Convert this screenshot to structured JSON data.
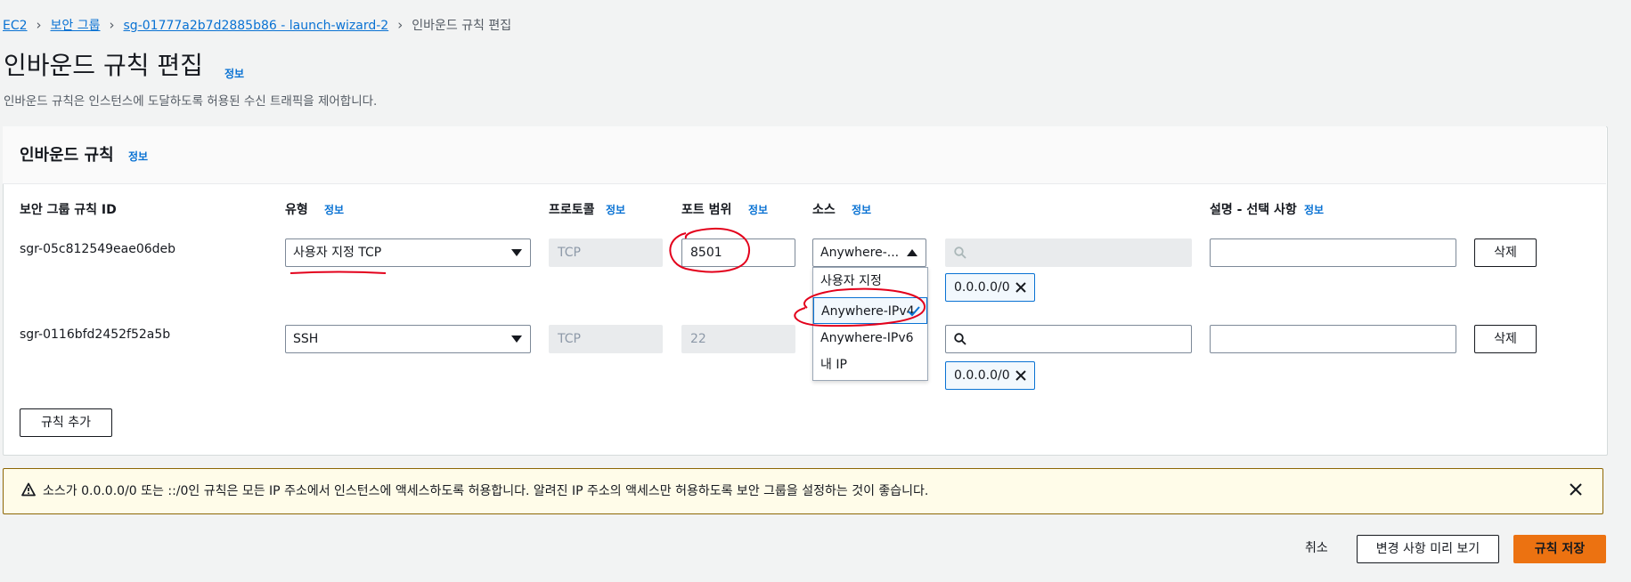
{
  "breadcrumb": {
    "items": [
      "EC2",
      "보안 그룹",
      "sg-01777a2b7d2885b86 - launch-wizard-2"
    ],
    "current": "인바운드 규칙 편집"
  },
  "page": {
    "title": "인바운드 규칙 편집",
    "info": "정보",
    "subtitle": "인바운드 규칙은 인스턴스에 도달하도록 허용된 수신 트래픽을 제어합니다."
  },
  "panel": {
    "title": "인바운드 규칙",
    "info": "정보",
    "columns": {
      "rule_id": "보안 그룹 규칙 ID",
      "type": "유형",
      "protocol": "프로토콜",
      "port_range": "포트 범위",
      "source": "소스",
      "description": "설명 - 선택 사항"
    },
    "info_label": "정보"
  },
  "rules": [
    {
      "id": "sgr-05c812549eae06deb",
      "type": "사용자 지정 TCP",
      "protocol": "TCP",
      "port": "8501",
      "source": "Anywhere-...",
      "cidr": "0.0.0.0/0",
      "description": "",
      "delete": "삭제"
    },
    {
      "id": "sgr-0116bfd2452f52a5b",
      "type": "SSH",
      "protocol": "TCP",
      "port": "22",
      "cidr": "0.0.0.0/0",
      "description": "",
      "delete": "삭제"
    }
  ],
  "dropdown": {
    "options": [
      "사용자 지정",
      "Anywhere-IPv4",
      "Anywhere-IPv6",
      "내 IP"
    ],
    "selected": "Anywhere-IPv4"
  },
  "add_rule": "규칙 추가",
  "alert": {
    "text": "소스가 0.0.0.0/0 또는 ::/0인 규칙은 모든 IP 주소에서 인스턴스에 액세스하도록 허용합니다. 알려진 IP 주소의 액세스만 허용하도록 보안 그룹을 설정하는 것이 좋습니다."
  },
  "footer": {
    "cancel": "취소",
    "preview": "변경 사항 미리 보기",
    "save": "규칙 저장"
  },
  "colors": {
    "link": "#0972d3",
    "primary": "#ec7211",
    "warning_bg": "#fffce9",
    "annotation": "#e3001b"
  }
}
